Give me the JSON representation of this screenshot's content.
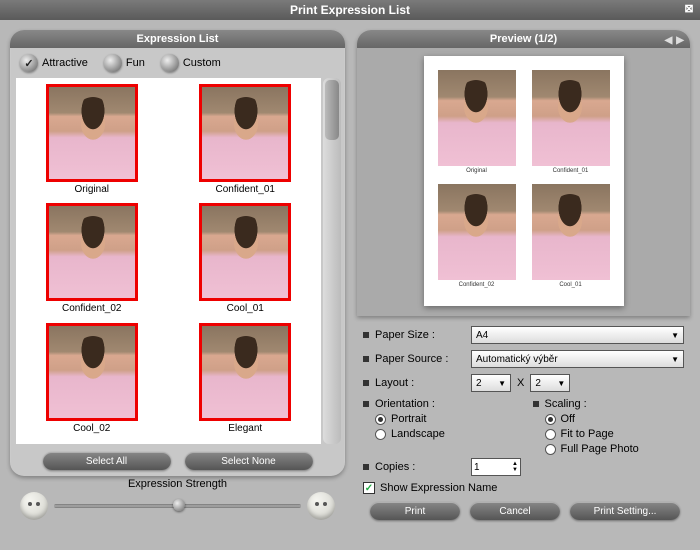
{
  "window": {
    "title": "Print Expression List",
    "close_glyph": "⊠"
  },
  "left": {
    "title": "Expression List",
    "tabs": [
      {
        "label": "Attractive",
        "active": true
      },
      {
        "label": "Fun",
        "active": false
      },
      {
        "label": "Custom",
        "active": false
      }
    ],
    "thumbs": [
      {
        "label": "Original"
      },
      {
        "label": "Confident_01"
      },
      {
        "label": "Confident_02"
      },
      {
        "label": "Cool_01"
      },
      {
        "label": "Cool_02"
      },
      {
        "label": "Elegant"
      }
    ],
    "select_all": "Select All",
    "select_none": "Select None",
    "strength_label": "Expression Strength"
  },
  "preview": {
    "title": "Preview (1/2)",
    "items": [
      {
        "label": "Original"
      },
      {
        "label": "Confident_01"
      },
      {
        "label": "Confident_02"
      },
      {
        "label": "Cool_01"
      }
    ]
  },
  "settings": {
    "paper_size_label": "Paper Size  :",
    "paper_size_value": "A4",
    "paper_source_label": "Paper Source  :",
    "paper_source_value": "Automatický výběr",
    "layout_label": "Layout  :",
    "layout_cols": "2",
    "layout_x": "X",
    "layout_rows": "2",
    "orientation_label": "Orientation  :",
    "portrait": "Portrait",
    "landscape": "Landscape",
    "orientation_value": "Portrait",
    "scaling_label": "Scaling  :",
    "scaling_off": "Off",
    "scaling_fit": "Fit to Page",
    "scaling_full": "Full Page Photo",
    "scaling_value": "Off",
    "copies_label": "Copies  :",
    "copies_value": "1",
    "show_name_label": "Show Expression Name",
    "show_name_checked": true
  },
  "buttons": {
    "print": "Print",
    "cancel": "Cancel",
    "print_setting": "Print Setting..."
  }
}
